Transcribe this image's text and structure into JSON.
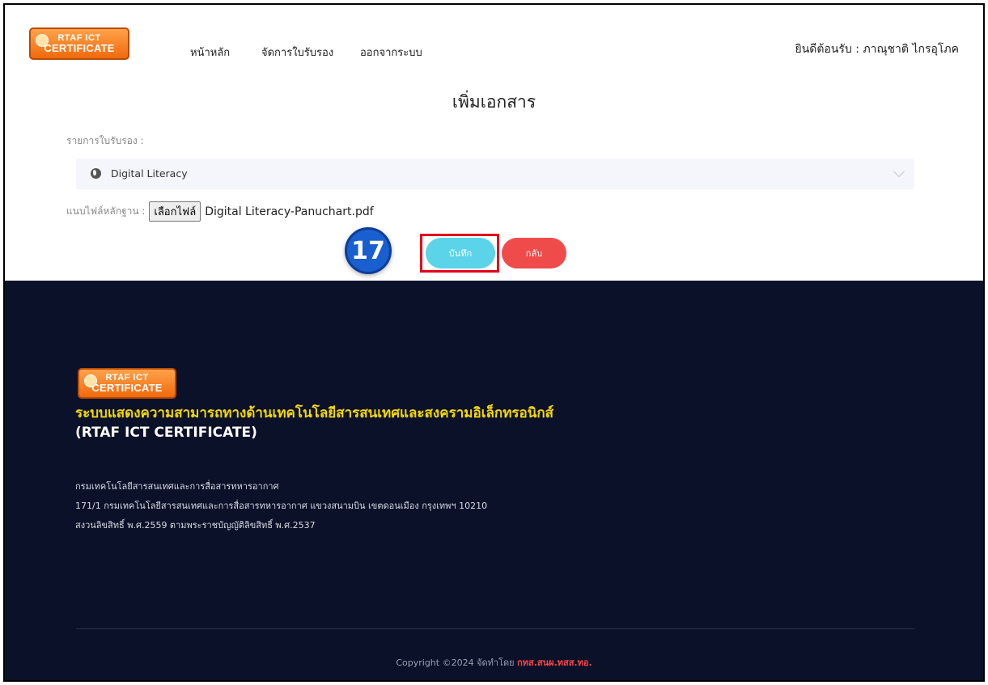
{
  "logo": {
    "line1": "RTAF ICT",
    "line2": "CERTIFICATE"
  },
  "nav": {
    "home": "หน้าหลัก",
    "manage": "จัดการใบรับรอง",
    "logout": "ออกจากระบบ"
  },
  "user": {
    "welcome": "ยินดีต้อนรับ : ภาณุชาติ ไกรอุโภค"
  },
  "page": {
    "title": "เพิ่มเอกสาร"
  },
  "form": {
    "certificate_label": "รายการใบรับรอง :",
    "certificate_value": "Digital Literacy",
    "attach_label": "แนบไฟล์หลักฐาน :",
    "choose_file_label": "เลือกไฟล์",
    "file_name": "Digital Literacy-Panuchart.pdf",
    "save_label": "บันทึก",
    "back_label": "กลับ"
  },
  "annotation": {
    "step_number": "17"
  },
  "footer": {
    "title": "ระบบแสดงความสามารถทางด้านเทคโนโลยีสารสนเทศและสงครามอิเล็กทรอนิกส์",
    "subtitle": "(RTAF ICT CERTIFICATE)",
    "org": "กรมเทคโนโลยีสารสนเทศและการสื่อสารทหารอากาศ",
    "address": "171/1 กรมเทคโนโลยีสารสนเทศและการสื่อสารทหารอากาศ แขวงสนามบิน เขตดอนเมือง กรุงเทพฯ 10210",
    "rights": "สงวนลิขสิทธิ์ พ.ศ.2559 ตามพระราชบัญญัติลิขสิทธิ์ พ.ศ.2537",
    "copyright_prefix": "Copyright ©2024 จัดทำโดย",
    "copyright_org": "กทส.สนผ.ทสส.ทอ."
  },
  "colors": {
    "save_button": "#5bd3e8",
    "back_button": "#ef4b4b",
    "footer_bg": "#0a1128",
    "footer_title": "#f5d800",
    "highlight_box": "#e3001b",
    "step_badge": "#1a5fd0"
  },
  "icons": {
    "certificate_select": "globe-icon",
    "dropdown": "chevron-down-icon"
  }
}
